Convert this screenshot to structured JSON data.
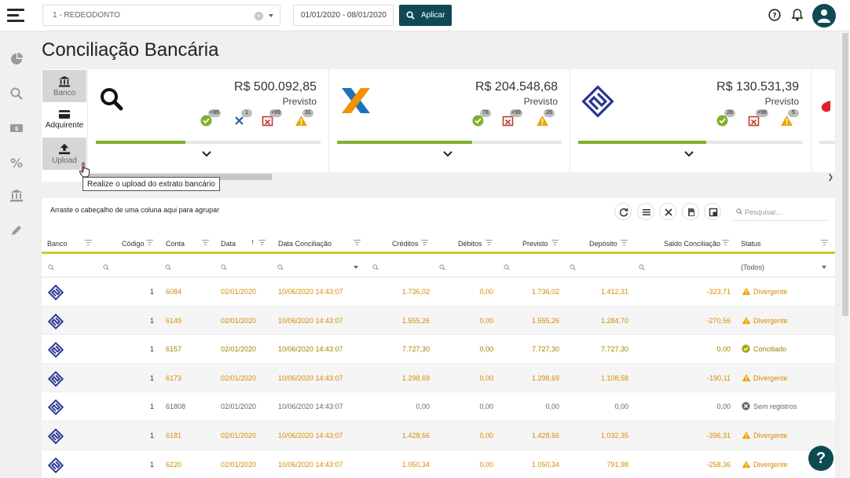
{
  "topbar": {
    "company": "1 - REDEODONTO",
    "dates": "01/01/2020 - 08/01/2020",
    "apply": "Aplicar"
  },
  "page": {
    "title": "Conciliação Bancária"
  },
  "side_tabs": {
    "banco": "Banco",
    "adquirente": "Adquirente",
    "upload": "Upload"
  },
  "tooltip": "Realize o upload do extrato bancário",
  "cards": [
    {
      "amount": "R$ 500.092,85",
      "label": "Previsto",
      "badges": [
        "+99",
        "1",
        "+99",
        "31"
      ],
      "progress": 0.4,
      "logo": "magnifier-logo"
    },
    {
      "amount": "R$ 204.548,68",
      "label": "Previsto",
      "badges": [
        "78",
        "+99",
        "26"
      ],
      "progress": 0.6,
      "logo": "caixa-logo"
    },
    {
      "amount": "R$ 130.531,39",
      "label": "Previsto",
      "badges": [
        "28",
        "+99",
        "5"
      ],
      "progress": 0.57,
      "logo": "banco-do-brasil-logo"
    }
  ],
  "grid": {
    "group_hint": "Arraste o cabeçalho de uma coluna aqui para agrupar",
    "search_placeholder": "Pesquisar...",
    "columns": [
      "Banco",
      "Código",
      "Conta",
      "Data",
      "Data Conciliação",
      "Créditos",
      "Débitos",
      "Previsto",
      "Depósito",
      "Saldo Conciliação",
      "Status"
    ],
    "filter_status": "(Todos)",
    "rows": [
      {
        "codigo": "1",
        "conta": "6084",
        "data": "02/01/2020",
        "data_conc": "10/06/2020 14:43:07",
        "creditos": "1.736,02",
        "debitos": "0,00",
        "previsto": "1.736,02",
        "deposito": "1.412,31",
        "saldo": "-323,71",
        "status": "Divergente",
        "tone": "orange"
      },
      {
        "codigo": "1",
        "conta": "6149",
        "data": "02/01/2020",
        "data_conc": "10/06/2020 14:43:07",
        "creditos": "1.555,26",
        "debitos": "0,00",
        "previsto": "1.555,26",
        "deposito": "1.284,70",
        "saldo": "-270,56",
        "status": "Divergente",
        "tone": "orange"
      },
      {
        "codigo": "1",
        "conta": "6157",
        "data": "02/01/2020",
        "data_conc": "10/06/2020 14:43:07",
        "creditos": "7.727,30",
        "debitos": "0,00",
        "previsto": "7.727,30",
        "deposito": "7.727,30",
        "saldo": "0,00",
        "status": "Conciliado",
        "tone": "gold"
      },
      {
        "codigo": "1",
        "conta": "6173",
        "data": "02/01/2020",
        "data_conc": "10/06/2020 14:43:07",
        "creditos": "1.298,69",
        "debitos": "0,00",
        "previsto": "1.298,69",
        "deposito": "1.108,58",
        "saldo": "-190,11",
        "status": "Divergente",
        "tone": "orange"
      },
      {
        "codigo": "1",
        "conta": "61808",
        "data": "02/01/2020",
        "data_conc": "10/06/2020 14:43:07",
        "creditos": "0,00",
        "debitos": "0,00",
        "previsto": "0,00",
        "deposito": "0,00",
        "saldo": "0,00",
        "status": "Sem registros",
        "tone": "gray"
      },
      {
        "codigo": "1",
        "conta": "6181",
        "data": "02/01/2020",
        "data_conc": "10/06/2020 14:43:07",
        "creditos": "1.428,66",
        "debitos": "0,00",
        "previsto": "1.428,66",
        "deposito": "1.032,35",
        "saldo": "-396,31",
        "status": "Divergente",
        "tone": "orange"
      },
      {
        "codigo": "1",
        "conta": "6220",
        "data": "02/01/2020",
        "data_conc": "10/06/2020 14:43:07",
        "creditos": "1.050,34",
        "debitos": "0,00",
        "previsto": "1.050,34",
        "deposito": "791,98",
        "saldo": "-258,36",
        "status": "Divergente",
        "tone": "orange"
      }
    ]
  },
  "colors": {
    "primary": "#0d4a54",
    "accent": "#c8cf24",
    "progress": "#7fb12a",
    "warning": "#e9a400",
    "success": "#7fb12a",
    "danger": "#c0392b"
  },
  "icons": [
    "menu-icon",
    "search-icon",
    "help-icon",
    "bell-icon",
    "user-icon",
    "chart-pie-icon",
    "search-icon",
    "money-icon",
    "percent-icon",
    "bank-icon",
    "pencil-icon",
    "refresh-icon",
    "column-chooser-icon",
    "clear-icon",
    "export-pdf-icon",
    "export-excel-icon",
    "filter-icon"
  ]
}
